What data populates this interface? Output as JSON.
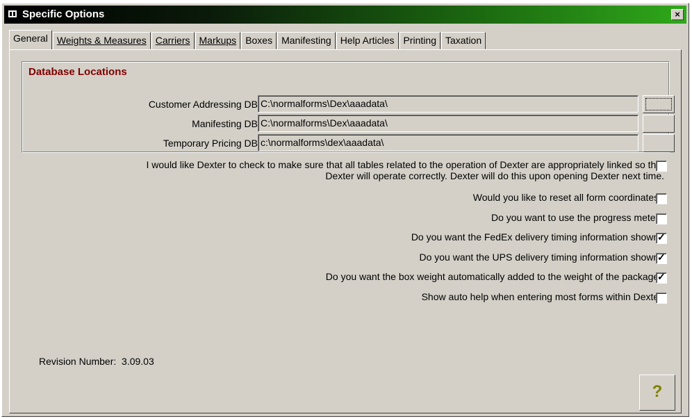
{
  "window": {
    "title": "Specific Options",
    "close_label": "×"
  },
  "tabs": [
    {
      "label": "General",
      "active": true
    },
    {
      "label": "Weights & Measures"
    },
    {
      "label": "Carriers"
    },
    {
      "label": "Markups"
    },
    {
      "label": "Boxes"
    },
    {
      "label": "Manifesting"
    },
    {
      "label": "Help Articles"
    },
    {
      "label": "Printing"
    },
    {
      "label": "Taxation"
    }
  ],
  "database": {
    "title": "Database Locations",
    "rows": [
      {
        "label": "Customer Addressing DB",
        "value": "C:\\normalforms\\Dex\\aaadata\\"
      },
      {
        "label": "Manifesting DB",
        "value": "C:\\normalforms\\Dex\\aaadata\\"
      },
      {
        "label": "Temporary Pricing DB",
        "value": "c:\\normalforms\\dex\\aaadata\\"
      }
    ]
  },
  "options": {
    "link_tables": {
      "line1": "I would like Dexter to check to make sure that all tables related to the operation of Dexter are appropriately linked so that",
      "line2": "Dexter will operate correctly. Dexter will do this upon opening Dexter next time.",
      "checked": false
    },
    "reset_coords": {
      "label": "Would you like to reset all form coordinates?",
      "checked": false
    },
    "progress_meter": {
      "label": "Do you want to use the progress meter?",
      "checked": false
    },
    "fedex_timing": {
      "label": "Do you want the FedEx delivery timing information shown?",
      "checked": true
    },
    "ups_timing": {
      "label": "Do you want the UPS delivery timing information shown?",
      "checked": true
    },
    "box_weight": {
      "label": "Do you want the box weight automatically added to the weight of the package?",
      "checked": true
    },
    "auto_help": {
      "label": "Show auto help when entering most forms within Dexter.",
      "checked": false
    }
  },
  "check_glyph": "✓",
  "revision": {
    "label": "Revision Number:",
    "value": "3.09.03"
  },
  "help_button": {
    "label": "?"
  }
}
